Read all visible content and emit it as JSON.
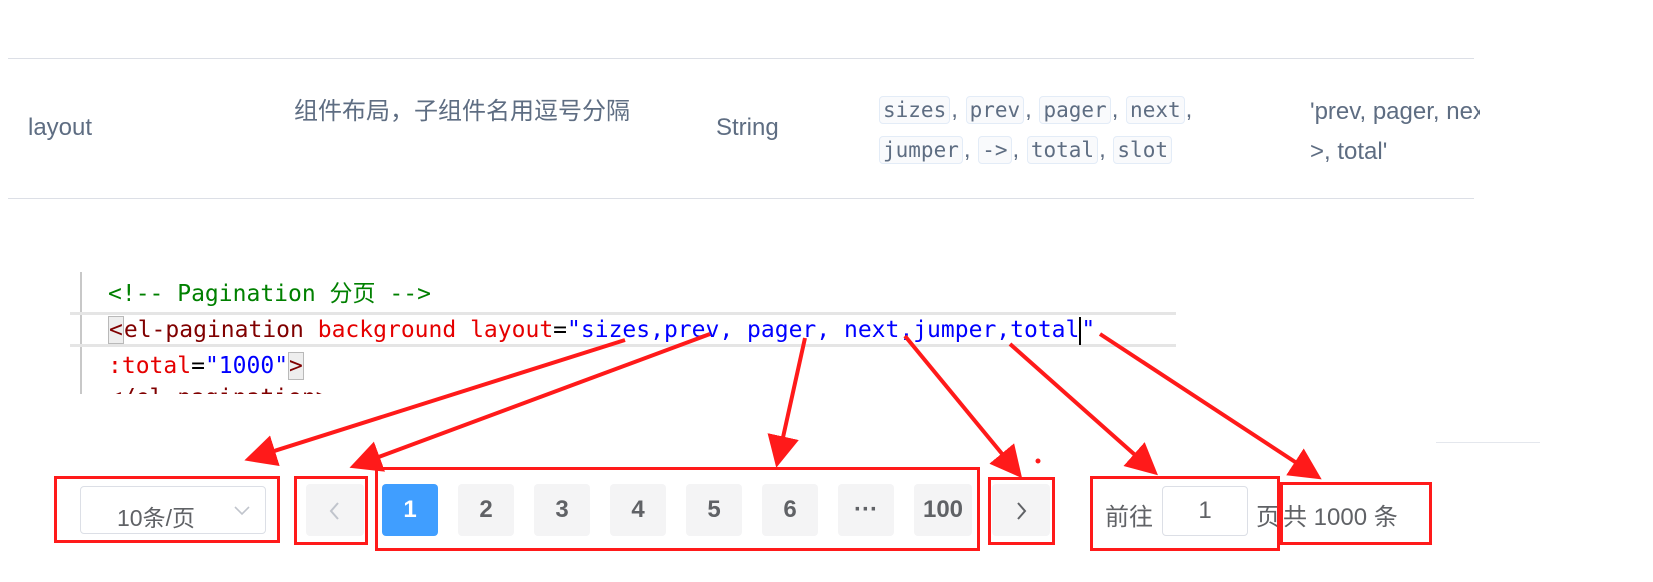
{
  "doc_table": {
    "attribute": "layout",
    "description": "组件布局，子组件名用逗号分隔",
    "type": "String",
    "options": [
      "sizes",
      "prev",
      "pager",
      "next",
      "jumper",
      "->",
      "total",
      "slot"
    ],
    "default": "'prev, pager, next, jumper, ->, total'"
  },
  "code": {
    "comment": "<!-- Pagination 分页 -->",
    "open_bracket": "<",
    "tag": "el-pagination",
    "attr_background": "background",
    "attr_layout": "layout",
    "eq": "=",
    "layout_value": "\"sizes,prev, pager, next,jumper,total",
    "quote_end": "\"",
    "total_attr": ":total",
    "total_value": "\"1000\"",
    "close_bracket": ">",
    "line4_partial": "</el-pagination>"
  },
  "pagination": {
    "page_size": "10条/页",
    "prev_icon": "chevron-left-icon",
    "pages": [
      "1",
      "2",
      "3",
      "4",
      "5",
      "6",
      "···",
      "100"
    ],
    "current_page": "1",
    "next_icon": "chevron-right-icon",
    "goto_label": "前往",
    "goto_value": "1",
    "page_suffix": "页",
    "total_text": "共 1000 条"
  },
  "colors": {
    "active_page": "#409eff",
    "annotation": "#ff1a1a"
  }
}
